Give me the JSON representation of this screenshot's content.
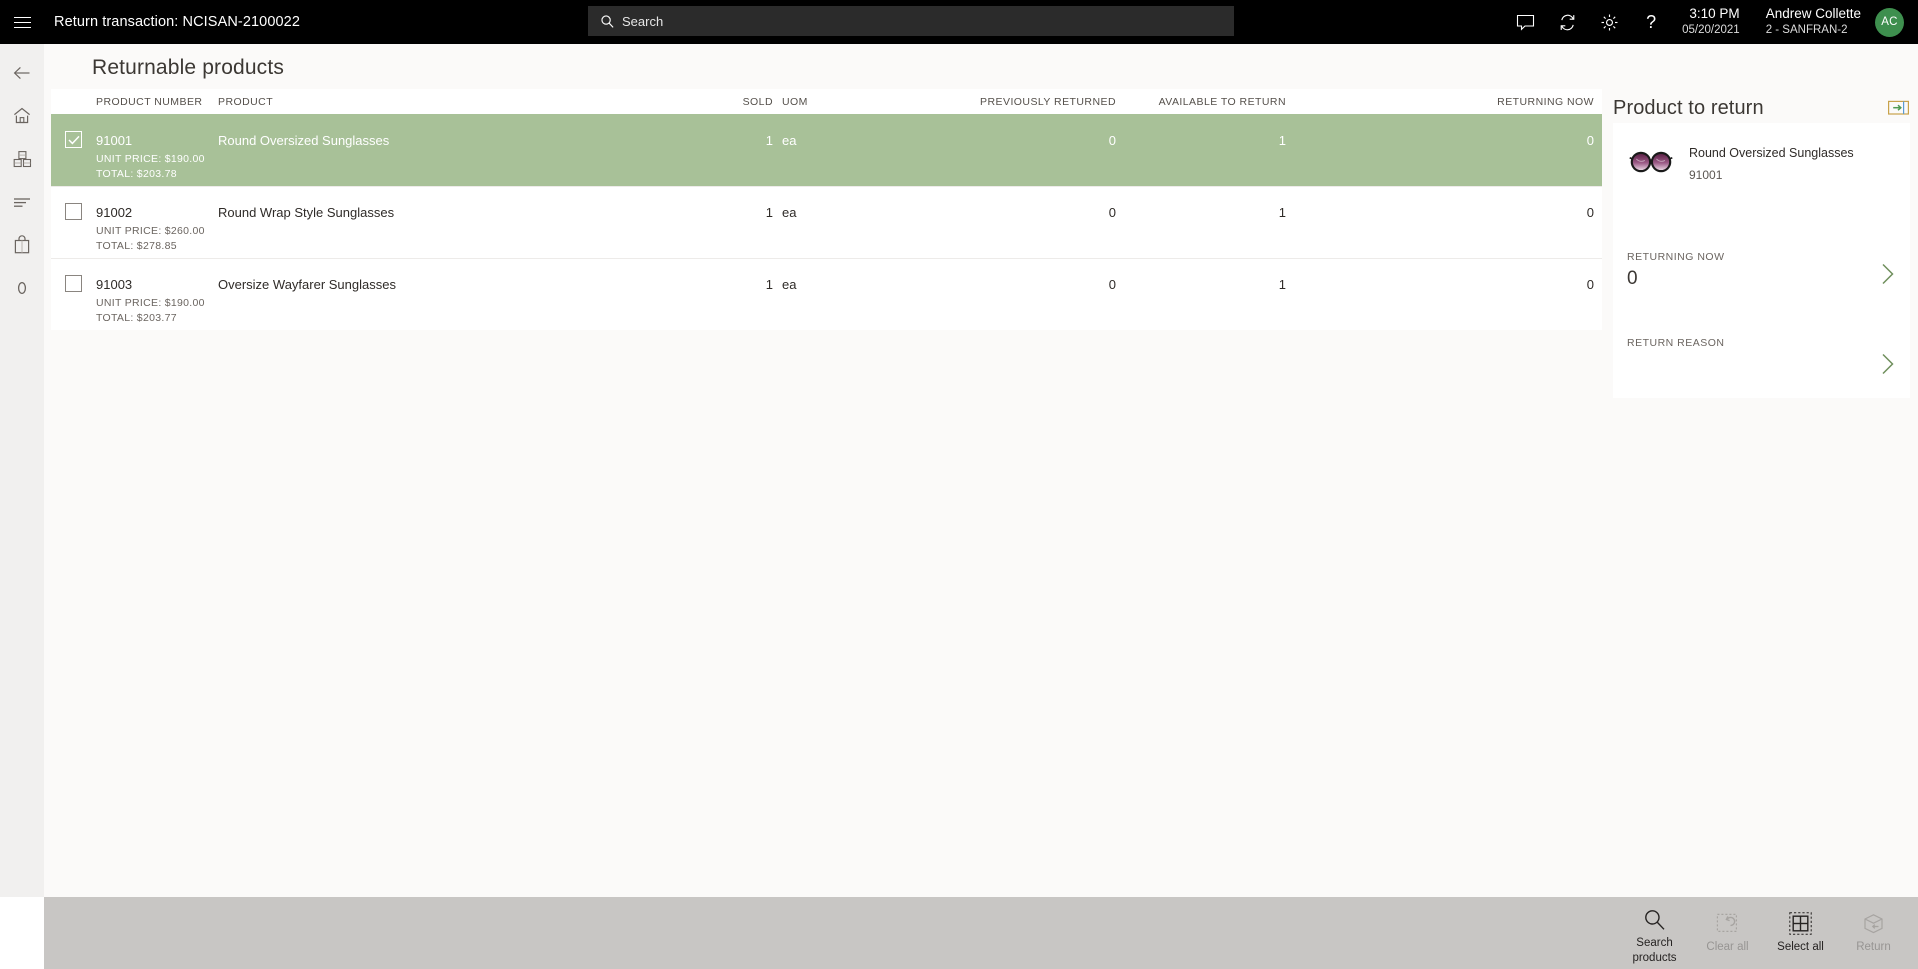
{
  "topbar": {
    "menu_icon": "hamburger-icon",
    "title": "Return transaction: NCISAN-2100022",
    "search": {
      "icon": "search-icon",
      "placeholder": "Search",
      "value": ""
    },
    "icons": [
      "message-icon",
      "sync-icon",
      "settings-gear-icon",
      "help-icon"
    ],
    "help_glyph": "?",
    "time": "3:10 PM",
    "date": "05/20/2021",
    "user_name": "Andrew Collette",
    "user_store": "2 - SANFRAN-2",
    "avatar_initials": "AC",
    "avatar_color": "#3e8f4e"
  },
  "rail": {
    "items": [
      {
        "name": "back-icon",
        "label": "Back"
      },
      {
        "name": "home-icon",
        "label": "Home"
      },
      {
        "name": "products-icon",
        "label": "Products"
      },
      {
        "name": "list-lines-icon",
        "label": "Journals"
      },
      {
        "name": "shopping-bag-icon",
        "label": "Cart"
      },
      {
        "name": "zero-count-icon",
        "label": "0"
      }
    ],
    "last_item_text": "0"
  },
  "main": {
    "page_title": "Returnable products",
    "table": {
      "columns": [
        {
          "key": "checkbox",
          "label": ""
        },
        {
          "key": "product_number",
          "label": "PRODUCT NUMBER"
        },
        {
          "key": "product",
          "label": "PRODUCT"
        },
        {
          "key": "sold",
          "label": "SOLD"
        },
        {
          "key": "uom",
          "label": "UOM"
        },
        {
          "key": "previously_returned",
          "label": "PREVIOUSLY RETURNED"
        },
        {
          "key": "available_to_return",
          "label": "AVAILABLE TO RETURN"
        },
        {
          "key": "returning_now",
          "label": "RETURNING NOW"
        }
      ],
      "selected_row_color": "#a8c198",
      "rows": [
        {
          "selected": true,
          "product_number": "91001",
          "product": "Round Oversized Sunglasses",
          "sold": "1",
          "uom": "ea",
          "previously_returned": "0",
          "available_to_return": "1",
          "returning_now": "0",
          "unit_price_line": "UNIT PRICE: $190.00",
          "total_line": "TOTAL: $203.78"
        },
        {
          "selected": false,
          "product_number": "91002",
          "product": "Round Wrap Style Sunglasses",
          "sold": "1",
          "uom": "ea",
          "previously_returned": "0",
          "available_to_return": "1",
          "returning_now": "0",
          "unit_price_line": "UNIT PRICE: $260.00",
          "total_line": "TOTAL: $278.85"
        },
        {
          "selected": false,
          "product_number": "91003",
          "product": "Oversize Wayfarer Sunglasses",
          "sold": "1",
          "uom": "ea",
          "previously_returned": "0",
          "available_to_return": "1",
          "returning_now": "0",
          "unit_price_line": "UNIT PRICE: $190.00",
          "total_line": "TOTAL: $203.77"
        }
      ]
    }
  },
  "panel": {
    "title": "Product to return",
    "expand_icon": "expand-panel-icon",
    "product": {
      "image": "sunglasses-thumbnail",
      "name": "Round Oversized Sunglasses",
      "number": "91001"
    },
    "returning_now_label": "RETURNING NOW",
    "returning_now_value": "0",
    "returning_now_chevron": "chevron-right-icon",
    "return_reason_label": "RETURN REASON",
    "return_reason_value": "",
    "return_reason_chevron": "chevron-right-icon"
  },
  "appbar": {
    "buttons": [
      {
        "name": "search-products-button",
        "icon": "magnifier-icon",
        "label": "Search products",
        "disabled": false
      },
      {
        "name": "clear-all-button",
        "icon": "clear-undo-icon",
        "label": "Clear all",
        "disabled": true
      },
      {
        "name": "select-all-button",
        "icon": "select-all-grid-icon",
        "label": "Select all",
        "disabled": false
      },
      {
        "name": "return-button",
        "icon": "return-box-icon",
        "label": "Return",
        "disabled": true
      }
    ]
  }
}
